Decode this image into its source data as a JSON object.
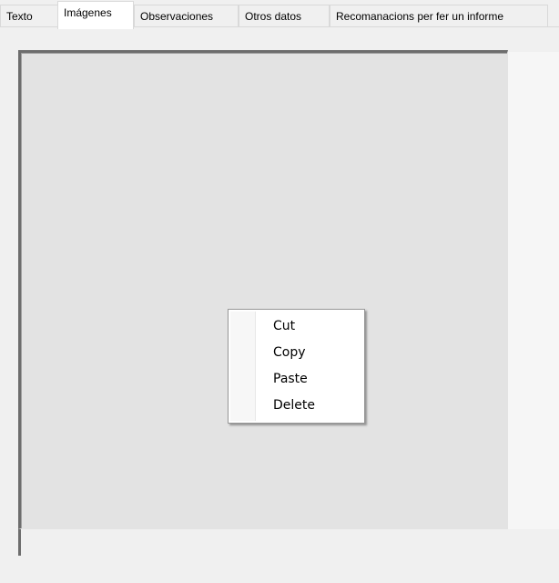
{
  "tabs": [
    {
      "label": "Texto",
      "selected": false
    },
    {
      "label": "Imágenes",
      "selected": true
    },
    {
      "label": "Observaciones",
      "selected": false
    },
    {
      "label": "Otros datos",
      "selected": false
    },
    {
      "label": "Recomanacions per fer un informe",
      "selected": false
    }
  ],
  "context_menu": {
    "items": [
      {
        "label": "Cut"
      },
      {
        "label": "Copy"
      },
      {
        "label": "Paste"
      },
      {
        "label": "Delete"
      }
    ]
  }
}
